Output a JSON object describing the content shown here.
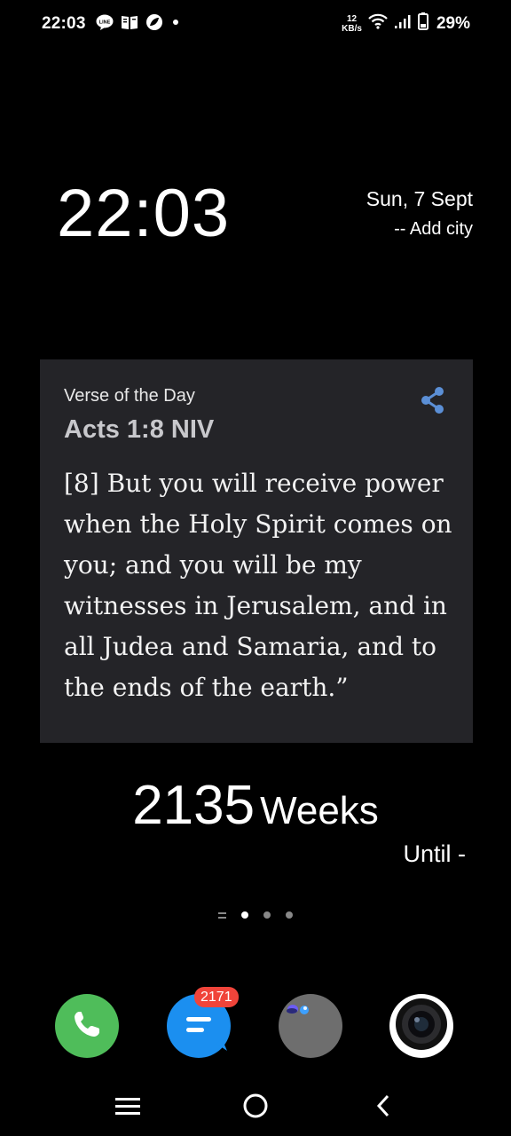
{
  "status_bar": {
    "time": "22:03",
    "network_speed_value": "12",
    "network_speed_unit": "KB/s",
    "battery_percent": "29%",
    "icons": [
      "line-icon",
      "book-icon",
      "leaf-app-icon",
      "dot-icon",
      "wifi-icon",
      "signal-icon",
      "battery-icon"
    ]
  },
  "clock_widget": {
    "time": "22:03",
    "date": "Sun, 7 Sept",
    "city": "-- Add city"
  },
  "verse_widget": {
    "label": "Verse of the Day",
    "reference": "Acts 1:8 NIV",
    "text": "[8] But you will receive power when the Holy Spirit comes on you; and you will be my witnesses in Jerusalem, and in all Judea and Samaria, and to the ends of the earth.”",
    "share_icon": "share-icon",
    "accent_color": "#5b8fd6"
  },
  "countdown_widget": {
    "value": "2135",
    "unit": "Weeks",
    "until": "Until -"
  },
  "page_indicator": {
    "pages": 3,
    "active_index": 0
  },
  "dock": {
    "apps": [
      {
        "name": "Phone",
        "icon": "phone-icon",
        "color": "#4fbd5a"
      },
      {
        "name": "Messages",
        "icon": "messages-icon",
        "color": "#1b8ff0",
        "badge": "2171"
      },
      {
        "name": "Folder",
        "icon": "folder-icon",
        "color": "#6e6e6e"
      },
      {
        "name": "Camera",
        "icon": "camera-icon",
        "color": "#ffffff"
      }
    ]
  },
  "nav_bar": {
    "buttons": [
      "recents-icon",
      "home-icon",
      "back-icon"
    ]
  }
}
